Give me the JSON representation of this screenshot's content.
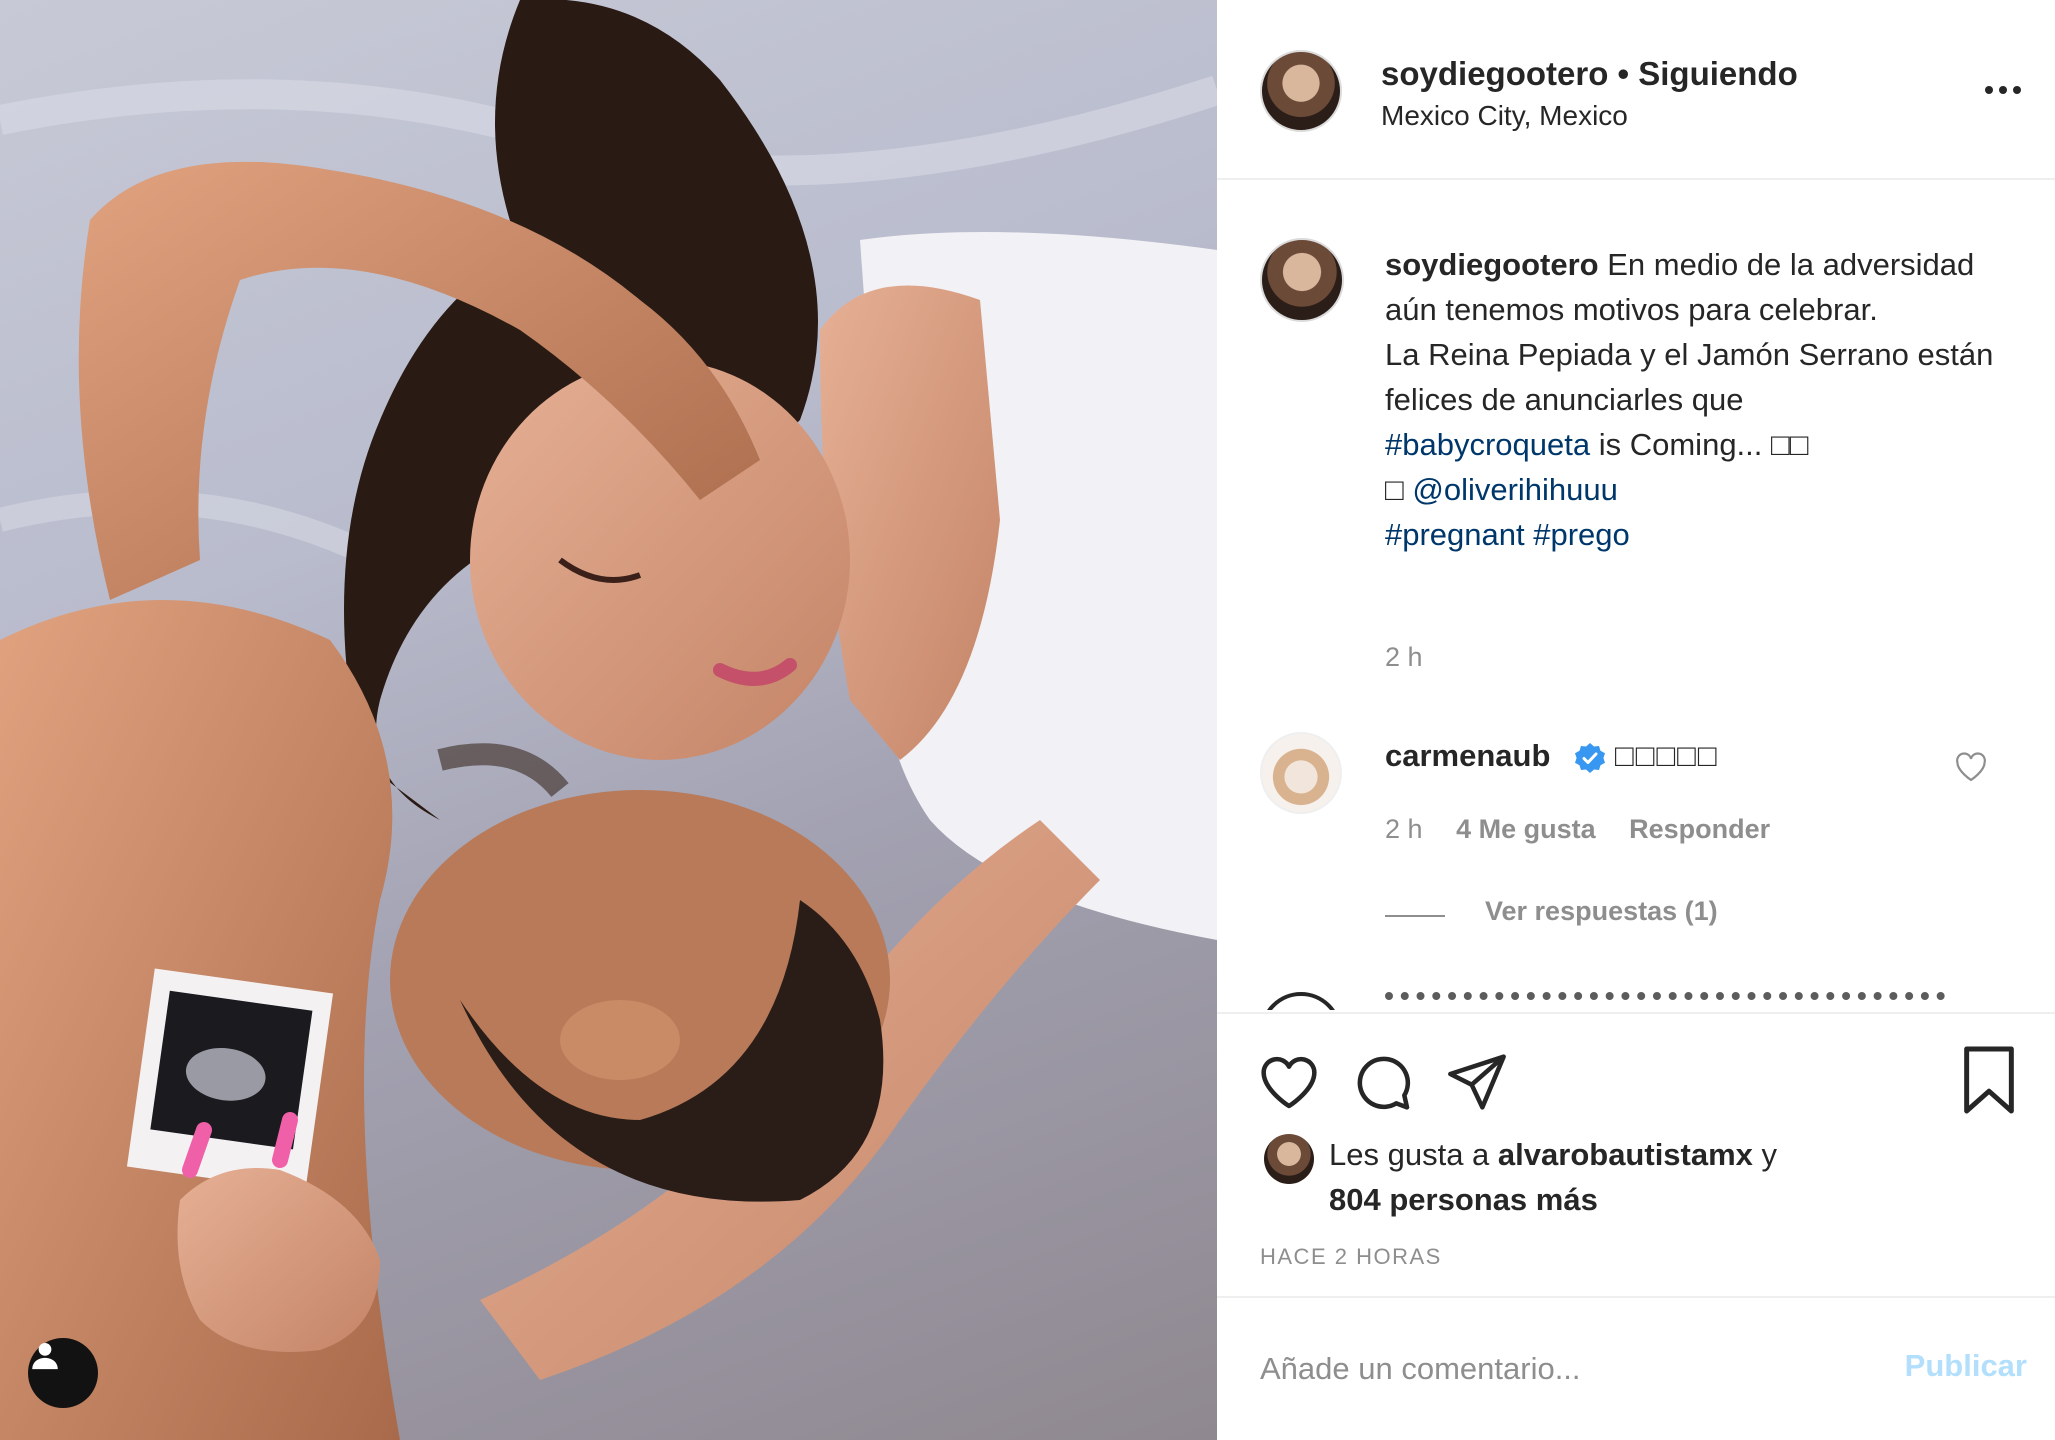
{
  "post": {
    "username": "soydiegootero",
    "separator": " • ",
    "follow_status": "Siguiendo",
    "location": "Mexico City, Mexico",
    "more_icon": "ellipsis-icon"
  },
  "caption": {
    "username": "soydiegootero",
    "line1": "En medio de la adversidad aún tenemos motivos para celebrar.",
    "line2": "La Reina Pepiada y el Jamón Serrano están felices de anunciarles que",
    "hashtag1": "#babycroqueta",
    "line3": "is Coming... □□",
    "emoji": "□",
    "mention": "@oliverihihuuu",
    "hashtag2": "#pregnant",
    "hashtag3": "#prego",
    "time": "2 h"
  },
  "comments": [
    {
      "username": "carmenaub",
      "text": "□□□□□",
      "time": "2 h",
      "likes": "4 Me gusta",
      "reply": "Responder",
      "view_replies": "Ver respuestas (1)"
    }
  ],
  "actions": {
    "like_icon": "heart-icon",
    "comment_icon": "comment-icon",
    "share_icon": "paper-plane-icon",
    "save_icon": "bookmark-icon"
  },
  "likes": {
    "prefix": "Les gusta a",
    "liker": "alvarobautistamx",
    "conj": "y",
    "others": "804 personas más"
  },
  "timestamp": "HACE 2 HORAS",
  "comment_box": {
    "placeholder": "Añade un comentario...",
    "publish": "Publicar"
  },
  "colors": {
    "link": "#00376b",
    "muted": "#8e8e8e",
    "publish_disabled": "#b2dffc",
    "verified": "#3897f0"
  }
}
